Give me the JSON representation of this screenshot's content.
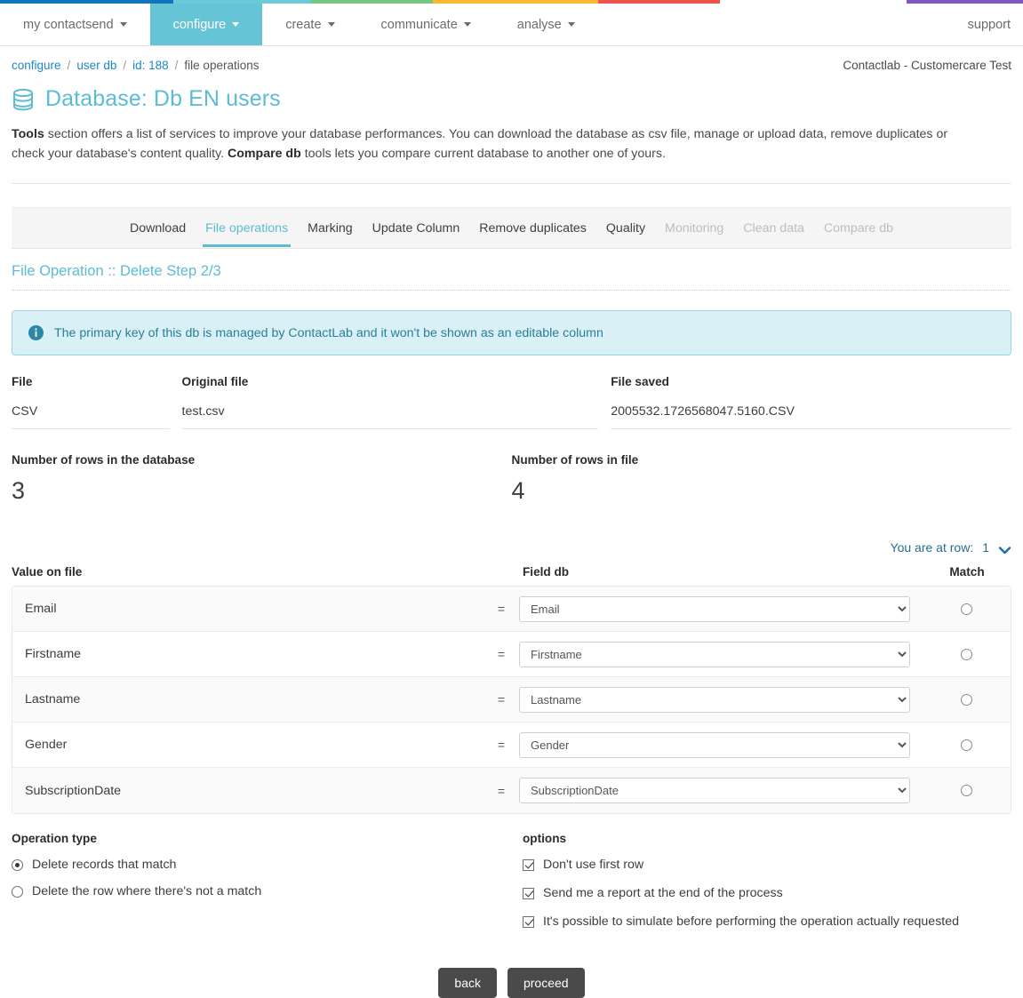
{
  "topnav": {
    "items": [
      {
        "label": "my contactsend",
        "caret": true,
        "active": false
      },
      {
        "label": "configure",
        "caret": true,
        "active": true
      },
      {
        "label": "create",
        "caret": true,
        "active": false
      },
      {
        "label": "communicate",
        "caret": true,
        "active": false
      },
      {
        "label": "analyse",
        "caret": true,
        "active": false
      }
    ],
    "support_label": "support"
  },
  "breadcrumb": {
    "items": [
      "configure",
      "user db",
      "id: 188",
      "file operations"
    ],
    "separator": "/"
  },
  "account": "Contactlab - Customercare Test",
  "page": {
    "title": "Database: Db EN users",
    "icon": "database-icon",
    "intro_bold_1": "Tools",
    "intro_text_1": " section offers a list of services to improve your database performances. You can download the database as csv file, manage or upload data, remove duplicates or check your database's content quality. ",
    "intro_bold_2": "Compare db",
    "intro_text_2": " tools lets you compare current database to another one of yours."
  },
  "tabs": [
    {
      "label": "Download",
      "state": "normal"
    },
    {
      "label": "File operations",
      "state": "active"
    },
    {
      "label": "Marking",
      "state": "normal"
    },
    {
      "label": "Update Column",
      "state": "normal"
    },
    {
      "label": "Remove duplicates",
      "state": "normal"
    },
    {
      "label": "Quality",
      "state": "normal"
    },
    {
      "label": "Monitoring",
      "state": "disabled"
    },
    {
      "label": "Clean data",
      "state": "disabled"
    },
    {
      "label": "Compare db",
      "state": "disabled"
    }
  ],
  "subtitle": "File Operation :: Delete Step 2/3",
  "alert": {
    "icon": "info-circle-icon",
    "message": "The primary key of this db is managed by ContactLab and it won't be shown as an editable column"
  },
  "file_meta": [
    {
      "label": "File",
      "value": "CSV"
    },
    {
      "label": "Original file",
      "value": "test.csv"
    },
    {
      "label": "File saved",
      "value": "2005532.1726568047.5160.CSV"
    }
  ],
  "counts": [
    {
      "label": "Number of rows in the database",
      "value": "3"
    },
    {
      "label": "Number of rows in file",
      "value": "4"
    }
  ],
  "row_selector": {
    "label": "You are at row:",
    "value": "1",
    "icon": "chevron-down-icon"
  },
  "mapping": {
    "headers": {
      "value_on_file": "Value on file",
      "field_db": "Field db",
      "match": "Match"
    },
    "equals_sign": "=",
    "rows": [
      {
        "value_on_file": "Email",
        "field_db": "Email",
        "match": false
      },
      {
        "value_on_file": "Firstname",
        "field_db": "Firstname",
        "match": false
      },
      {
        "value_on_file": "Lastname",
        "field_db": "Lastname",
        "match": false
      },
      {
        "value_on_file": "Gender",
        "field_db": "Gender",
        "match": false
      },
      {
        "value_on_file": "SubscriptionDate",
        "field_db": "SubscriptionDate",
        "match": false
      }
    ]
  },
  "operation_type": {
    "title": "Operation type",
    "options": [
      {
        "label": "Delete records that match",
        "selected": true
      },
      {
        "label": "Delete the row where there's not a match",
        "selected": false
      }
    ]
  },
  "options": {
    "title": "options",
    "items": [
      {
        "label": "Don't use first row",
        "checked": true
      },
      {
        "label": "Send me a report at the end of the process",
        "checked": true
      },
      {
        "label": "It's possible to simulate before performing the operation actually requested",
        "checked": true
      }
    ]
  },
  "footer": {
    "back_label": "back",
    "proceed_label": "proceed"
  },
  "colors": {
    "accent_teal": "#5cbcd3",
    "nav_active": "#65c5d6",
    "link_blue": "#1e87c4",
    "alert_bg": "#d9f0f6",
    "alert_border": "#97d7e6",
    "alert_text": "#2a7f97",
    "strip": [
      "#1074bc",
      "#6bc9da",
      "#77c883",
      "#fbb82e",
      "#ef5350",
      "#8255c4"
    ],
    "button_bg": "#4a4a4a"
  }
}
